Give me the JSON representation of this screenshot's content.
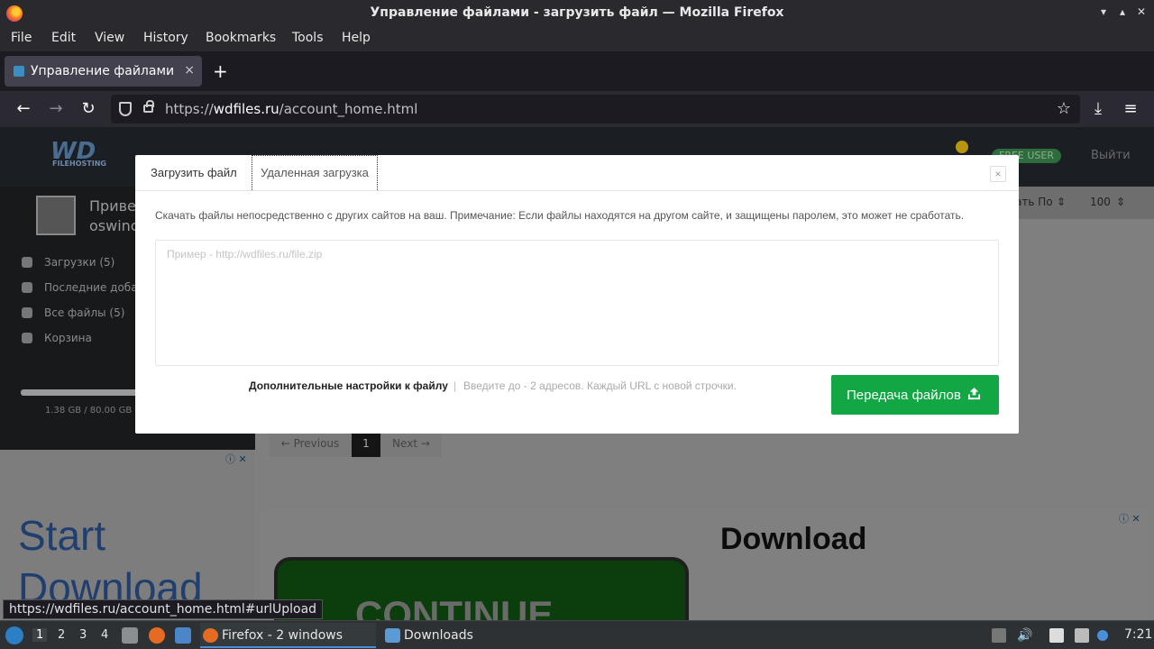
{
  "window": {
    "title": "Управление файлами - загрузить файл — Mozilla Firefox"
  },
  "menu": [
    "File",
    "Edit",
    "View",
    "History",
    "Bookmarks",
    "Tools",
    "Help"
  ],
  "tab": {
    "label": "Управление файлами - ",
    "close": "×",
    "new_tab": "+"
  },
  "navbar": {
    "back": "←",
    "forward": "→",
    "reload": "↻",
    "url_scheme": "https://",
    "url_domain": "wdfiles.ru",
    "url_path": "/account_home.html",
    "bookmark": "☆",
    "download": "⤓",
    "menu": "≡"
  },
  "page": {
    "logo": "WD",
    "logo_sub": "FILEHOSTING",
    "plan_badge": "FREE USER",
    "logout": "Выйти",
    "greeting": "Привет",
    "username": "oswinc",
    "sidebar": [
      {
        "label": "Загрузки (5)",
        "icon": "cloud-upload-icon"
      },
      {
        "label": "Последние добав",
        "icon": "clock-icon"
      },
      {
        "label": "Все файлы (5)",
        "icon": "folder-icon"
      },
      {
        "label": "Корзина",
        "icon": "trash-icon"
      }
    ],
    "storage_used": "1.38 GB / 80.00 GB",
    "sort_label": "ать По",
    "per_page": "100",
    "pager": {
      "prev": "← Previous",
      "current": "1",
      "next": "Next →"
    },
    "ad_left": [
      "Start",
      "Download"
    ],
    "ad_right_title": "Download",
    "ad_right_button": "CONTINUE"
  },
  "modal": {
    "tab_upload": "Загрузить файл",
    "tab_remote": "Удаленная загрузка",
    "close": "×",
    "description": "Скачать файлы непосредственно с других сайтов на ваш. Примечание: Если файлы находятся на другом сайте, и защищены паролем, это может не сработать.",
    "url_placeholder": "Пример - http://wdfiles.ru/file.zip",
    "url_value": "",
    "options_label": "Дополнительные настройки к файлу",
    "separator": "|",
    "hint": "Введите до - 2 адресов. Каждый URL с новой строчки.",
    "submit_label": "Передача файлов"
  },
  "status_url": "https://wdfiles.ru/account_home.html#urlUpload",
  "taskbar": {
    "workspaces": [
      "1",
      "2",
      "3",
      "4"
    ],
    "active_workspace": "1",
    "tasks": [
      {
        "label": "Firefox - 2 windows",
        "icon": "firefox-icon"
      },
      {
        "label": "Downloads",
        "icon": "folder-icon"
      }
    ],
    "clock": "7:21"
  },
  "colors": {
    "submit_button": "#12a644",
    "titlebar": "#2a2a2e",
    "tab_active": "#42414d"
  }
}
